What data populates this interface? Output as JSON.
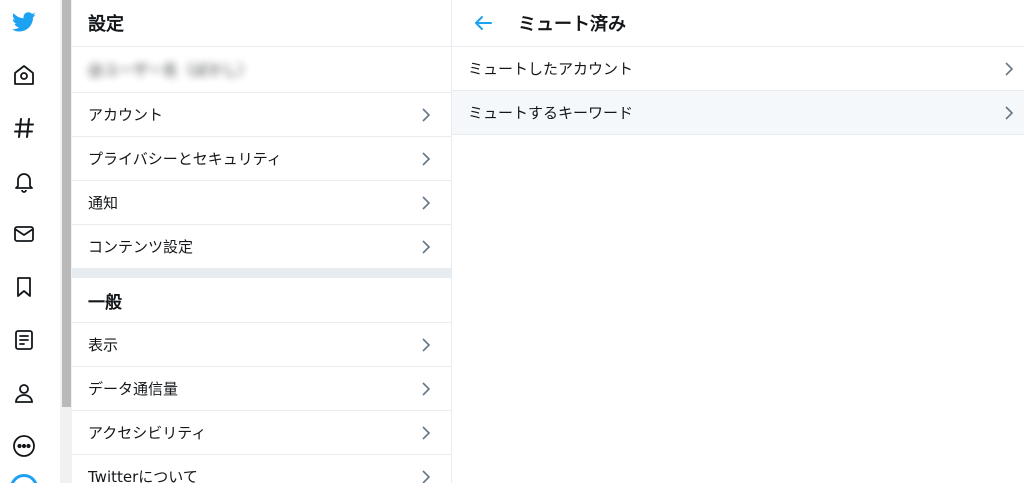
{
  "nav": {
    "icons": [
      "twitter-logo-icon",
      "home-icon",
      "hashtag-icon",
      "bell-icon",
      "mail-icon",
      "bookmark-icon",
      "list-icon",
      "profile-icon",
      "more-icon"
    ]
  },
  "settings": {
    "title": "設定",
    "account_name": "@ユーザー名（ぼかし）",
    "items": [
      {
        "label": "アカウント"
      },
      {
        "label": "プライバシーとセキュリティ"
      },
      {
        "label": "通知"
      },
      {
        "label": "コンテンツ設定"
      }
    ],
    "general": {
      "title": "一般",
      "items": [
        {
          "label": "表示"
        },
        {
          "label": "データ通信量"
        },
        {
          "label": "アクセシビリティ"
        },
        {
          "label": "Twitterについて"
        }
      ]
    }
  },
  "muted": {
    "title": "ミュート済み",
    "items": [
      {
        "label": "ミュートしたアカウント"
      },
      {
        "label": "ミュートするキーワード"
      }
    ]
  },
  "colors": {
    "accent": "#1da1f2",
    "icon": "#14171a",
    "border": "#e6ecf0",
    "hover": "#f5f8fa"
  }
}
